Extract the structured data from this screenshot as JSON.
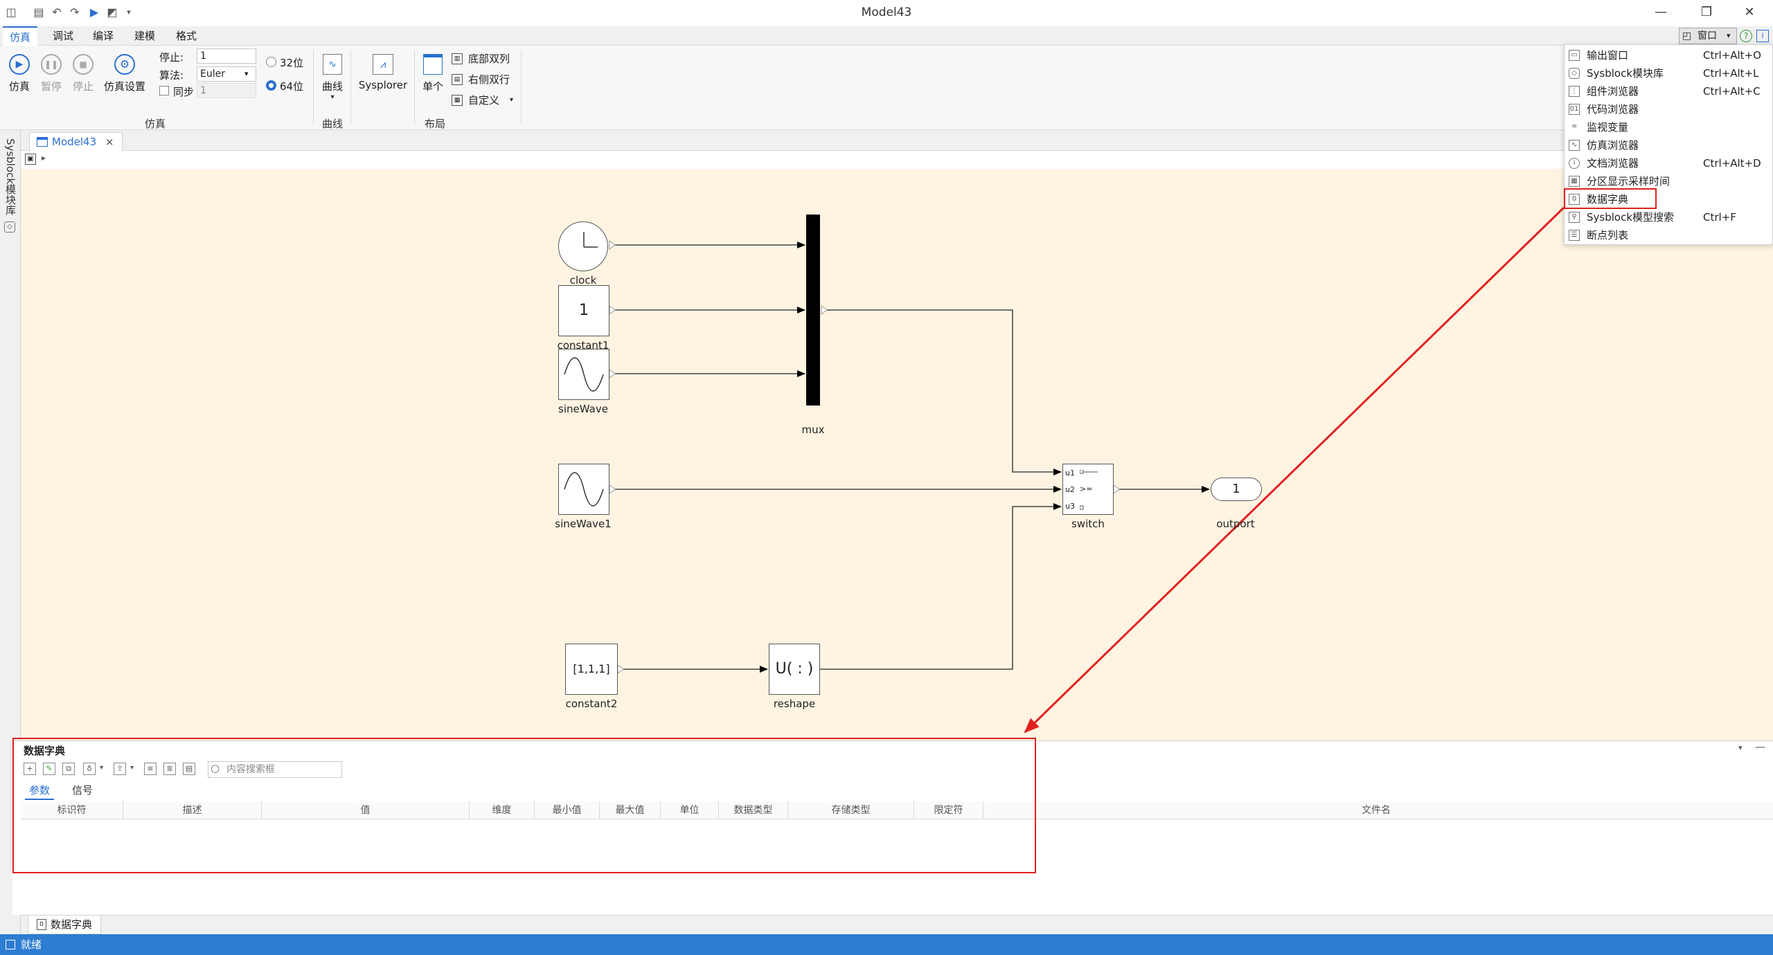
{
  "window": {
    "title": "Model43"
  },
  "menubar": {
    "tabs": [
      "仿真",
      "调试",
      "编译",
      "建模",
      "格式"
    ]
  },
  "ribbon": {
    "simulate": "仿真",
    "pause": "暂停",
    "stop": "停止",
    "sim_settings": "仿真设置",
    "stop_time_label": "停止:",
    "stop_time_value": "1",
    "algorithm_label": "算法:",
    "algorithm_value": "Euler",
    "sync_label": "同步",
    "sync_value": "1",
    "bit32": "32位",
    "bit64": "64位",
    "group_sim": "仿真",
    "curve": "曲线",
    "group_curve": "曲线",
    "sysplorer": "Sysplorer",
    "single": "单个",
    "bottom_two_col": "底部双列",
    "right_two_row": "右侧双行",
    "custom": "自定义",
    "group_layout": "布局",
    "window_button": "窗口"
  },
  "sidebar": {
    "label": "Sysblock模块库"
  },
  "document_tab": {
    "label": "Model43",
    "close": "×"
  },
  "diagram": {
    "blocks": {
      "clock": "clock",
      "constant1": "constant1",
      "constant1_value": "1",
      "sinewave": "sineWave",
      "mux": "mux",
      "sinewave1": "sineWave1",
      "switch": "switch",
      "switch_u1": "u1",
      "switch_u2": "u2",
      "switch_u3": "u3",
      "switch_cond": ">=",
      "outport": "outport",
      "outport_value": "1",
      "constant2": "constant2",
      "constant2_value": "[1,1,1]",
      "reshape": "reshape",
      "reshape_value": "U( : )"
    }
  },
  "data_dictionary": {
    "title": "数据字典",
    "search_placeholder": "内容搜索框",
    "tabs": [
      "参数",
      "信号"
    ],
    "columns": [
      "标识符",
      "描述",
      "值",
      "维度",
      "最小值",
      "最大值",
      "单位",
      "数据类型",
      "存储类型",
      "限定符",
      "文件名"
    ]
  },
  "bottom_tab": {
    "label": "数据字典"
  },
  "status": {
    "text": "就绪"
  },
  "window_menu": {
    "items": [
      {
        "label": "输出窗口",
        "shortcut": "Ctrl+Alt+O"
      },
      {
        "label": "Sysblock模块库",
        "shortcut": "Ctrl+Alt+L"
      },
      {
        "label": "组件浏览器",
        "shortcut": "Ctrl+Alt+C"
      },
      {
        "label": "代码浏览器",
        "shortcut": ""
      },
      {
        "label": "监视变量",
        "shortcut": ""
      },
      {
        "label": "仿真浏览器",
        "shortcut": ""
      },
      {
        "label": "文档浏览器",
        "shortcut": "Ctrl+Alt+D"
      },
      {
        "label": "分区显示采样时间",
        "shortcut": ""
      },
      {
        "label": "数据字典",
        "shortcut": ""
      },
      {
        "label": "Sysblock模型搜索",
        "shortcut": "Ctrl+F"
      },
      {
        "label": "断点列表",
        "shortcut": ""
      }
    ]
  },
  "colors": {
    "accent": "#2a6fd0",
    "canvas": "#fff4e2",
    "highlight": "#e02020",
    "status": "#2d7dd2"
  }
}
